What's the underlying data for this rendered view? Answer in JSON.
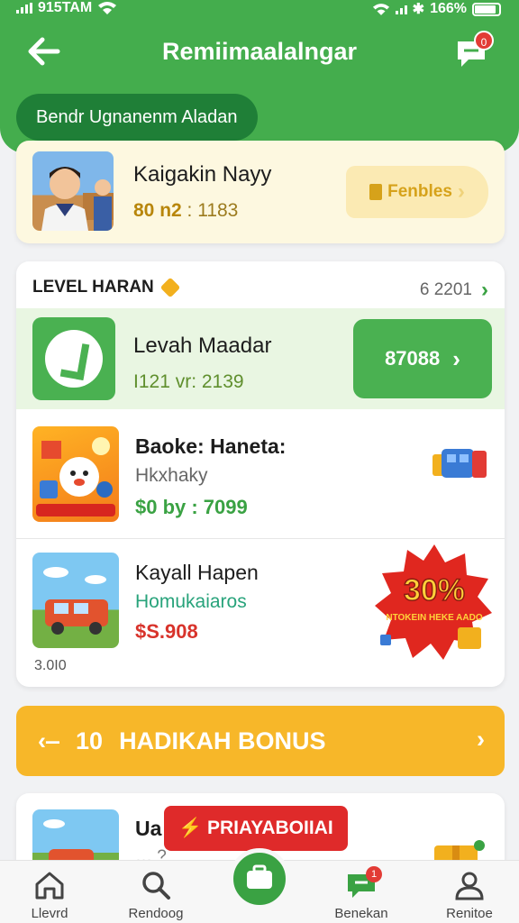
{
  "status_bar": {
    "carrier": "915TAM",
    "battery": "166%"
  },
  "header": {
    "title": "Remiimaalalngar",
    "chat_badge": "0"
  },
  "filter_chip": {
    "label": "Bendr Ugnanenm Aladan"
  },
  "profile": {
    "name": "Kaigakin Nayy",
    "meta_prefix": "80 n2",
    "meta_suffix": " : 1183",
    "feature_button": "Fenbles"
  },
  "offers": {
    "title": "LEVEL HARAN",
    "link": "6 2201",
    "highlight": {
      "name": "Levah  Maadar",
      "meta": "I121 vr: 2139",
      "button": "87088"
    },
    "items": [
      {
        "name": "Baoke: Haneta:",
        "sub": "Hkxhaky",
        "price": "$0 by : 7099"
      },
      {
        "name": "Kayall Hapen",
        "sub": "Homukaiaros",
        "price": "$S.908"
      }
    ],
    "footer": "3.0I0",
    "discount": {
      "percent": "30%",
      "tag": "NTOKEIN HEKE AADO"
    }
  },
  "bonus_bar": {
    "count": "10",
    "label": "HADIKAH BONUS"
  },
  "promo": {
    "name": "Ua",
    "badge": "PRIAYABOIIAI",
    "sub": "…   ? "
  },
  "nav": {
    "items": [
      {
        "label": "Llevrd"
      },
      {
        "label": "Rendoog"
      },
      {
        "label": "Benekan",
        "badge": "1"
      },
      {
        "label": "Renitoe"
      }
    ]
  },
  "colors": {
    "primary_green": "#44ad4d",
    "accent_yellow": "#f7b729",
    "sale_red": "#df2a2a"
  }
}
